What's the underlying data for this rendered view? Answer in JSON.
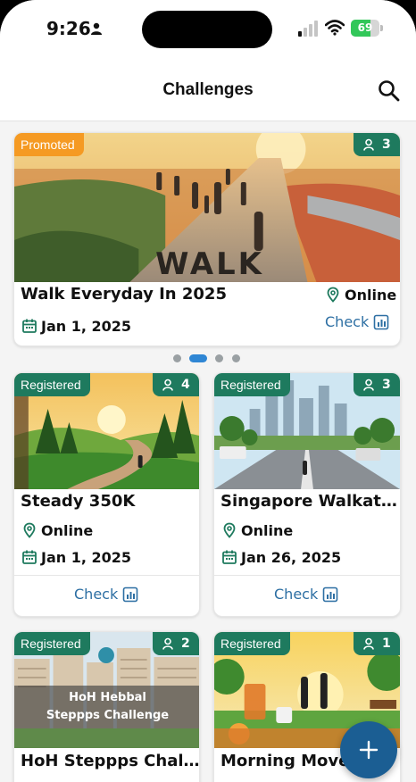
{
  "status_bar": {
    "time": "9:26",
    "battery": 69
  },
  "header": {
    "title": "Challenges"
  },
  "colors": {
    "brand_green": "#1e7a5e",
    "promoted_orange": "#f59a23",
    "link_blue": "#2d6fa3",
    "fab_blue": "#1b5e93"
  },
  "carousel": {
    "active_index": 1,
    "count": 4
  },
  "featured": {
    "tag": "Promoted",
    "participants": "3",
    "image_text": "WALK",
    "title": "Walk Everyday In 2025",
    "mode": "Online",
    "date": "Jan 1, 2025",
    "action": "Check"
  },
  "cards": [
    {
      "tag": "Registered",
      "participants": "4",
      "title": "Steady 350K",
      "mode": "Online",
      "date": "Jan 1, 2025",
      "action": "Check"
    },
    {
      "tag": "Registered",
      "participants": "3",
      "title": "Singapore Walkathon",
      "mode": "Online",
      "date": "Jan 26, 2025",
      "action": "Check"
    },
    {
      "tag": "Registered",
      "participants": "2",
      "image_text": [
        "HoH Hebbal",
        "Steppps Challenge"
      ],
      "title": "HoH Steppps Challenge"
    },
    {
      "tag": "Registered",
      "participants": "1",
      "title": "Morning Movers"
    }
  ],
  "icons": {
    "search": "search-icon",
    "location": "location-pin-icon",
    "calendar": "calendar-icon",
    "chart": "bar-chart-icon",
    "participants": "person-icon",
    "add": "plus-icon"
  }
}
